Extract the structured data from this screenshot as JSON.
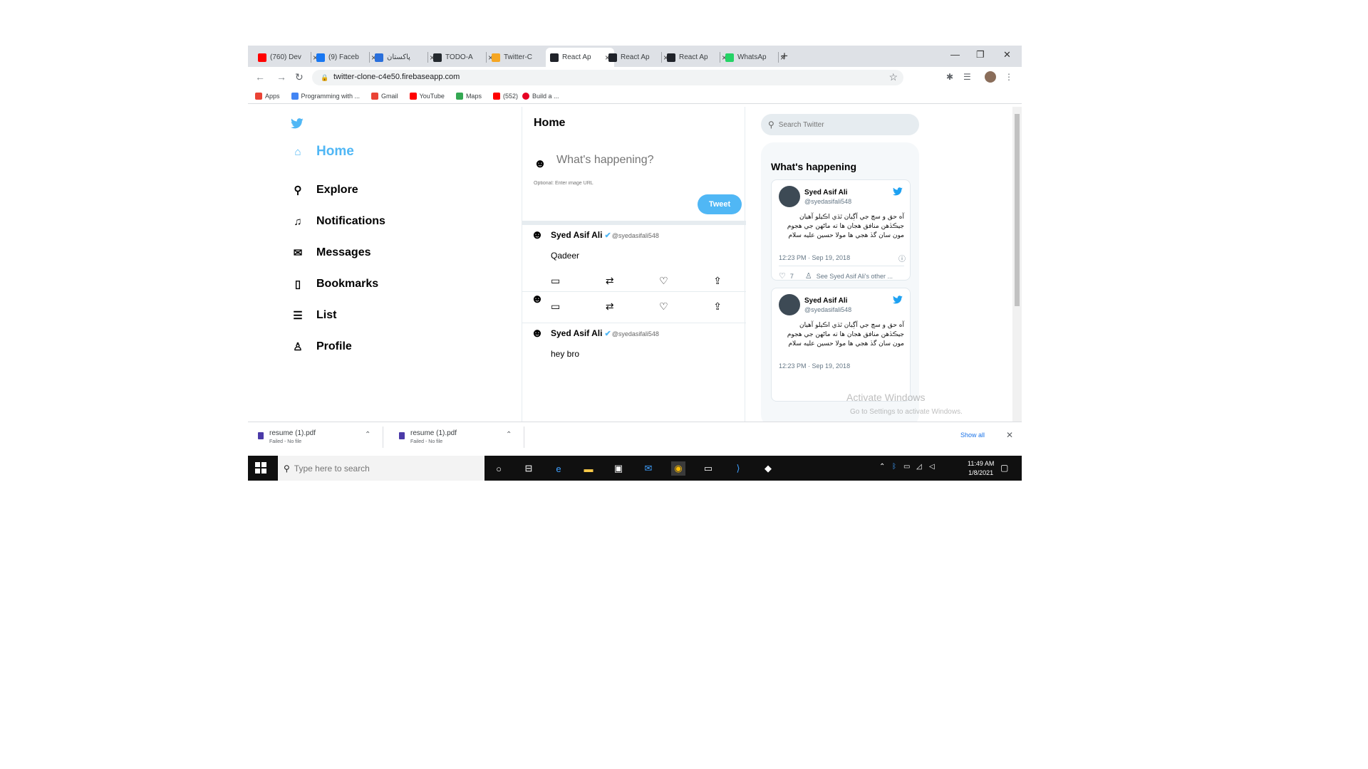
{
  "browser": {
    "tabs": [
      {
        "title": "(760) Dev",
        "color": "#ff0000"
      },
      {
        "title": "(9) Faceb",
        "color": "#1877f2"
      },
      {
        "title": "پاکستان",
        "color": "#2a6fdb"
      },
      {
        "title": "TODO-A",
        "color": "#24292e"
      },
      {
        "title": "Twitter-C",
        "color": "#f5a623"
      },
      {
        "title": "React Ap",
        "color": "#20232a"
      },
      {
        "title": "React Ap",
        "color": "#20232a"
      },
      {
        "title": "React Ap",
        "color": "#20232a"
      },
      {
        "title": "WhatsAp",
        "color": "#25d366"
      }
    ],
    "tab_close": "×",
    "new_tab": "+",
    "url": "twitter-clone-c4e50.firebaseapp.com",
    "bookmarks": [
      {
        "label": "Apps",
        "color": "#ea4335"
      },
      {
        "label": "Programming with ...",
        "color": "#4285f4"
      },
      {
        "label": "Gmail",
        "color": "#ea4335"
      },
      {
        "label": "YouTube",
        "color": "#ff0000"
      },
      {
        "label": "Maps",
        "color": "#34a853"
      },
      {
        "label": "(552)",
        "color": "#ff0000"
      },
      {
        "label": "Build a ...",
        "color": "#e60023"
      }
    ]
  },
  "sidebar": {
    "items": [
      {
        "label": "Home",
        "icon": "home-icon",
        "glyph": "⌂"
      },
      {
        "label": "Explore",
        "icon": "search-icon",
        "glyph": "⚲"
      },
      {
        "label": "Notifications",
        "icon": "bell-icon",
        "glyph": "♫"
      },
      {
        "label": "Messages",
        "icon": "mail-icon",
        "glyph": "✉"
      },
      {
        "label": "Bookmarks",
        "icon": "bookmark-icon",
        "glyph": "▯"
      },
      {
        "label": "List",
        "icon": "list-icon",
        "glyph": "☰"
      },
      {
        "label": "Profile",
        "icon": "profile-icon",
        "glyph": "♙"
      }
    ]
  },
  "feed": {
    "title": "Home",
    "composer_placeholder": "What's happening?",
    "image_placeholder": "Optional: Enter image URL",
    "tweet_button": "Tweet",
    "posts": [
      {
        "name": "Syed Asif Ali",
        "verified": "✔",
        "handle": "@syedasifali548",
        "text": "Qadeer"
      },
      {
        "name": "",
        "verified": "",
        "handle": "",
        "text": ""
      },
      {
        "name": "Syed Asif Ali",
        "verified": "✔",
        "handle": "@syedasifali548",
        "text": "hey bro"
      }
    ]
  },
  "rightbar": {
    "search_placeholder": "Search Twitter",
    "happening_title": "What's happening",
    "embeds": [
      {
        "name": "Syed Asif Ali",
        "handle": "@syedasifali548",
        "text": "آه حق و سچ جي آڳيان ٿڌي اڪيلو آهيان جيڪڏهن منافق هجان ها ته ماڻهن جي هجوم مون سان گڏ هجي ها مولا حسين عليه سلام",
        "time": "12:23 PM · Sep 19, 2018",
        "likes": "7",
        "see_more": "See Syed Asif Ali's other ..."
      },
      {
        "name": "Syed Asif Ali",
        "handle": "@syedasifali548",
        "text": "آه حق و سچ جي آڳيان ٿڌي اڪيلو آهيان جيڪڏهن منافق هجان ها ته ماڻهن جي هجوم مون سان گڏ هجي ها مولا حسين عليه سلام",
        "time": "12:23 PM · Sep 19, 2018"
      }
    ]
  },
  "watermark": {
    "title": "Activate Windows",
    "subtitle": "Go to Settings to activate Windows."
  },
  "downloads": {
    "items": [
      {
        "name": "resume (1).pdf",
        "status": "Failed - No file"
      },
      {
        "name": "resume (1).pdf",
        "status": "Failed - No file"
      }
    ],
    "show_all": "Show all"
  },
  "taskbar": {
    "search_placeholder": "Type here to search",
    "time": "11:49 AM",
    "date": "1/8/2021"
  }
}
